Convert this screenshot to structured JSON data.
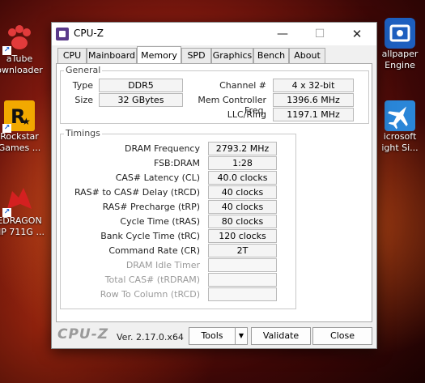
{
  "desktop": {
    "icons_left": [
      {
        "label1": "aTube",
        "label2": "ownloader"
      },
      {
        "label1": "Rockstar",
        "label2": "Games ..."
      },
      {
        "label1": "EDRAGON",
        "label2": "HP 711G ..."
      }
    ],
    "icons_right": [
      {
        "label1": "allpaper",
        "label2": "Engine"
      },
      {
        "label1": "icrosoft",
        "label2": "ight Si..."
      }
    ]
  },
  "window": {
    "title": "CPU-Z",
    "min": "—",
    "max": "☐",
    "close": "✕",
    "tabs": [
      "CPU",
      "Mainboard",
      "Memory",
      "SPD",
      "Graphics",
      "Bench",
      "About"
    ],
    "active_tab": "Memory"
  },
  "general": {
    "title": "General",
    "type_label": "Type",
    "type_value": "DDR5",
    "size_label": "Size",
    "size_value": "32 GBytes",
    "channel_label": "Channel #",
    "channel_value": "4 x 32-bit",
    "mcf_label": "Mem Controller Freq.",
    "mcf_value": "1396.6 MHz",
    "llc_label": "LLC/Ring",
    "llc_value": "1197.1 MHz"
  },
  "timings": {
    "title": "Timings",
    "rows": [
      {
        "label": "DRAM Frequency",
        "value": "2793.2 MHz"
      },
      {
        "label": "FSB:DRAM",
        "value": "1:28"
      },
      {
        "label": "CAS# Latency (CL)",
        "value": "40.0 clocks"
      },
      {
        "label": "RAS# to CAS# Delay (tRCD)",
        "value": "40 clocks"
      },
      {
        "label": "RAS# Precharge (tRP)",
        "value": "40 clocks"
      },
      {
        "label": "Cycle Time (tRAS)",
        "value": "80 clocks"
      },
      {
        "label": "Bank Cycle Time (tRC)",
        "value": "120 clocks"
      },
      {
        "label": "Command Rate (CR)",
        "value": "2T"
      },
      {
        "label": "DRAM Idle Timer",
        "value": ""
      },
      {
        "label": "Total CAS# (tRDRAM)",
        "value": ""
      },
      {
        "label": "Row To Column (tRCD)",
        "value": ""
      }
    ]
  },
  "footer": {
    "brand": "CPU-Z",
    "version": "Ver. 2.17.0.x64",
    "tools": "Tools",
    "tools_arrow": "▼",
    "validate": "Validate",
    "close": "Close"
  }
}
